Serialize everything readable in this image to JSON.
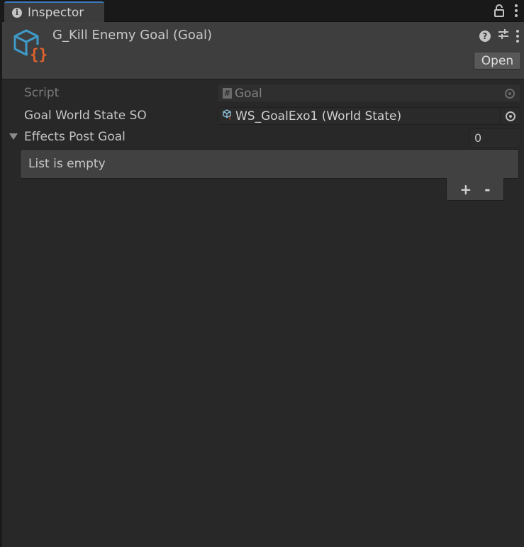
{
  "tab": {
    "label": "Inspector",
    "icon": "info-icon"
  },
  "header": {
    "title": "G_Kill Enemy Goal (Goal)",
    "open_label": "Open",
    "help_glyph": "?",
    "asset_icon_braces": "{}"
  },
  "fields": {
    "script": {
      "label": "Script",
      "value": "Goal",
      "icon_glyph": "#"
    },
    "world_state": {
      "label": "Goal World State SO",
      "value": "WS_GoalExo1 (World State)"
    },
    "effects": {
      "label": "Effects Post Goal",
      "count": "0"
    }
  },
  "list": {
    "empty_text": "List is empty",
    "add_label": "+",
    "remove_label": "-"
  },
  "colors": {
    "tab_accent": "#3a79bb",
    "asset_cube": "#3f9ac8",
    "asset_braces": "#e0622e"
  }
}
